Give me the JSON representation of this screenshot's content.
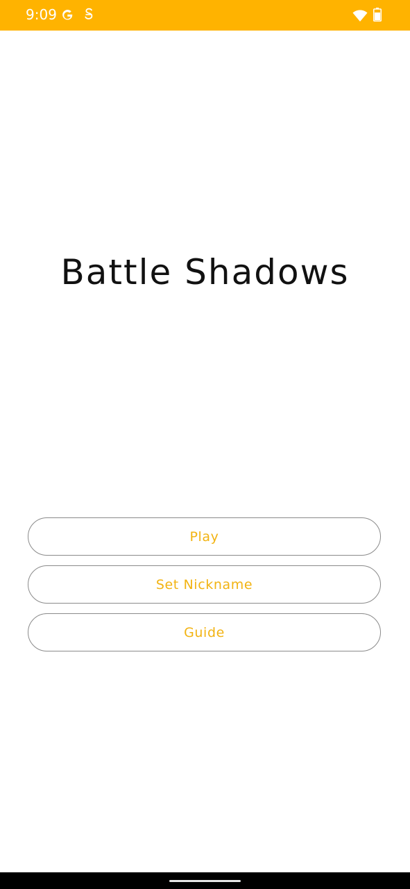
{
  "status_bar": {
    "time": "9:09",
    "background_color": "#ffb300",
    "icons": [
      "google-g-icon",
      "s-app-icon",
      "wifi-icon",
      "battery-icon"
    ]
  },
  "app": {
    "title": "Battle Shadows"
  },
  "menu": {
    "play_label": "Play",
    "nickname_label": "Set Nickname",
    "guide_label": "Guide",
    "button_text_color": "#f2b312",
    "button_border_color": "#8a8a8a"
  }
}
